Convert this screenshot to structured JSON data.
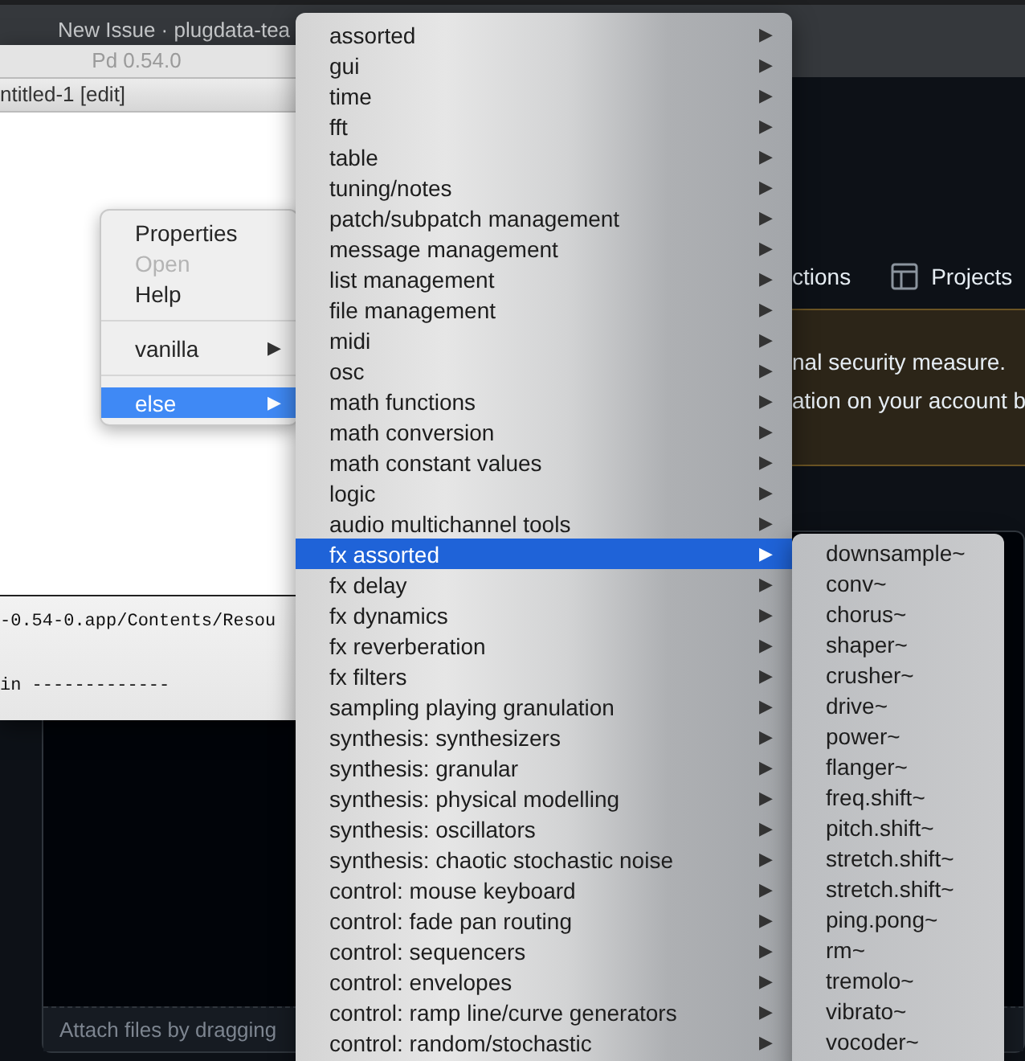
{
  "browser": {
    "tab_title": "New Issue · plugdata-tea",
    "nav_items": [
      {
        "label": "ctions",
        "icon": false
      },
      {
        "label": "Projects",
        "icon": true
      }
    ],
    "banner_lines": [
      "nal security measure.",
      "ation on your account b"
    ],
    "attach_hint": "Attach files by dragging"
  },
  "pd_window": {
    "title": "Pd 0.54.0",
    "console_lines": [
      "-0.54-0.app/Contents/Resou",
      "in -------------"
    ]
  },
  "patch_window": {
    "title": "ntitled-1 [edit]"
  },
  "context_menu": {
    "items": [
      {
        "kind": "item",
        "label": "Properties",
        "disabled": false,
        "selected": false
      },
      {
        "kind": "item",
        "label": "Open",
        "disabled": true,
        "selected": false
      },
      {
        "kind": "item",
        "label": "Help",
        "disabled": false,
        "selected": false
      },
      {
        "kind": "separator"
      },
      {
        "kind": "submenu",
        "label": "vanilla",
        "arrow": "▶",
        "disabled": false,
        "selected": false
      },
      {
        "kind": "separator"
      },
      {
        "kind": "submenu",
        "label": "else",
        "arrow": "▶",
        "disabled": false,
        "selected": true
      }
    ]
  },
  "else_menu": {
    "items": [
      {
        "label": "assorted",
        "arrow": "▶",
        "selected": false
      },
      {
        "label": "gui",
        "arrow": "▶",
        "selected": false
      },
      {
        "label": "time",
        "arrow": "▶",
        "selected": false
      },
      {
        "label": "fft",
        "arrow": "▶",
        "selected": false
      },
      {
        "label": "table",
        "arrow": "▶",
        "selected": false
      },
      {
        "label": "tuning/notes",
        "arrow": "▶",
        "selected": false
      },
      {
        "label": "patch/subpatch management",
        "arrow": "▶",
        "selected": false
      },
      {
        "label": "message management",
        "arrow": "▶",
        "selected": false
      },
      {
        "label": "list management",
        "arrow": "▶",
        "selected": false
      },
      {
        "label": "file management",
        "arrow": "▶",
        "selected": false
      },
      {
        "label": "midi",
        "arrow": "▶",
        "selected": false
      },
      {
        "label": "osc",
        "arrow": "▶",
        "selected": false
      },
      {
        "label": "math functions",
        "arrow": "▶",
        "selected": false
      },
      {
        "label": "math conversion",
        "arrow": "▶",
        "selected": false
      },
      {
        "label": "math constant values",
        "arrow": "▶",
        "selected": false
      },
      {
        "label": "logic",
        "arrow": "▶",
        "selected": false
      },
      {
        "label": "audio multichannel tools",
        "arrow": "▶",
        "selected": false
      },
      {
        "label": "fx assorted",
        "arrow": "▶",
        "selected": true
      },
      {
        "label": "fx delay",
        "arrow": "▶",
        "selected": false
      },
      {
        "label": "fx dynamics",
        "arrow": "▶",
        "selected": false
      },
      {
        "label": "fx reverberation",
        "arrow": "▶",
        "selected": false
      },
      {
        "label": "fx filters",
        "arrow": "▶",
        "selected": false
      },
      {
        "label": "sampling playing granulation",
        "arrow": "▶",
        "selected": false
      },
      {
        "label": "synthesis: synthesizers",
        "arrow": "▶",
        "selected": false
      },
      {
        "label": "synthesis: granular",
        "arrow": "▶",
        "selected": false
      },
      {
        "label": "synthesis: physical modelling",
        "arrow": "▶",
        "selected": false
      },
      {
        "label": "synthesis: oscillators",
        "arrow": "▶",
        "selected": false
      },
      {
        "label": "synthesis: chaotic stochastic noise",
        "arrow": "▶",
        "selected": false
      },
      {
        "label": "control: mouse keyboard",
        "arrow": "▶",
        "selected": false
      },
      {
        "label": "control: fade pan routing",
        "arrow": "▶",
        "selected": false
      },
      {
        "label": "control: sequencers",
        "arrow": "▶",
        "selected": false
      },
      {
        "label": "control: envelopes",
        "arrow": "▶",
        "selected": false
      },
      {
        "label": "control: ramp line/curve generators",
        "arrow": "▶",
        "selected": false
      },
      {
        "label": "control: random/stochastic",
        "arrow": "▶",
        "selected": false
      }
    ]
  },
  "fx_menu": {
    "items": [
      {
        "label": "downsample~",
        "selected": false
      },
      {
        "label": "conv~",
        "selected": false
      },
      {
        "label": "chorus~",
        "selected": false
      },
      {
        "label": "shaper~",
        "selected": false
      },
      {
        "label": "crusher~",
        "selected": false
      },
      {
        "label": "drive~",
        "selected": false
      },
      {
        "label": "power~",
        "selected": false
      },
      {
        "label": "flanger~",
        "selected": false
      },
      {
        "label": "freq.shift~",
        "selected": false
      },
      {
        "label": "pitch.shift~",
        "selected": false
      },
      {
        "label": "stretch.shift~",
        "selected": false
      },
      {
        "label": "stretch.shift~",
        "selected": false
      },
      {
        "label": "ping.pong~",
        "selected": false
      },
      {
        "label": "rm~",
        "selected": false
      },
      {
        "label": "tremolo~",
        "selected": false
      },
      {
        "label": "vibrato~",
        "selected": false
      },
      {
        "label": "vocoder~",
        "selected": false
      }
    ]
  }
}
